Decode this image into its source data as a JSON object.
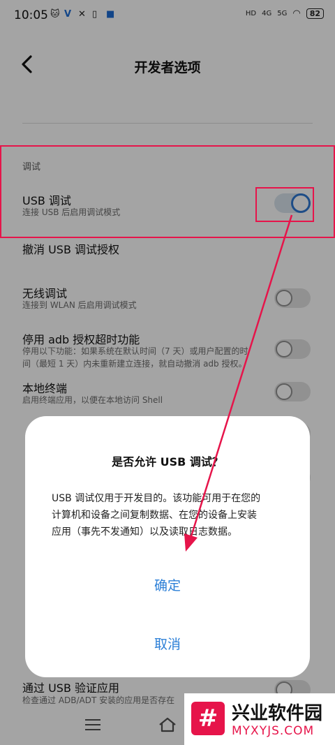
{
  "status_bar": {
    "time": "10:05",
    "battery": "82",
    "net1": "HD",
    "net2": "4G",
    "net3": "5G"
  },
  "header": {
    "title": "开发者选项"
  },
  "settings": {
    "section_title": "调试",
    "usb_debug": {
      "title": "USB 调试",
      "subtitle": "连接 USB 后启用调试模式",
      "enabled": true
    },
    "revoke": {
      "title": "撤消 USB 调试授权"
    },
    "wireless": {
      "title": "无线调试",
      "subtitle": "连接到 WLAN 后启用调试模式",
      "enabled": false
    },
    "adb_timeout": {
      "title": "停用 adb 授权超时功能",
      "subtitle_line1": "停用以下功能：如果系统在默认时间（7 天）或用户配置的时",
      "subtitle_line2": "间（最短 1 天）内未重新建立连接，就自动撤消 adb 授权。",
      "enabled": false
    },
    "local_terminal": {
      "title": "本地终端",
      "subtitle": "启用终端应用，以便在本地访问 Shell",
      "enabled": false
    },
    "verify_usb": {
      "title": "通过 USB 验证应用",
      "subtitle": "检查通过 ADB/ADT 安装的应用是否存在"
    }
  },
  "dialog": {
    "title": "是否允许 USB 调试？",
    "body_line1": "USB 调试仅用于开发目的。该功能可用于在您的",
    "body_line2": "计算机和设备之间复制数据、在您的设备上安装",
    "body_line3": "应用（事先不发通知）以及读取日志数据。",
    "confirm_label": "确定",
    "cancel_label": "取消"
  },
  "watermark": {
    "logo_char": "#",
    "name": "兴业软件园",
    "site": "MYXYJS.COM"
  },
  "colors": {
    "accent": "#2b7fd7",
    "annotation": "#e6144a"
  }
}
